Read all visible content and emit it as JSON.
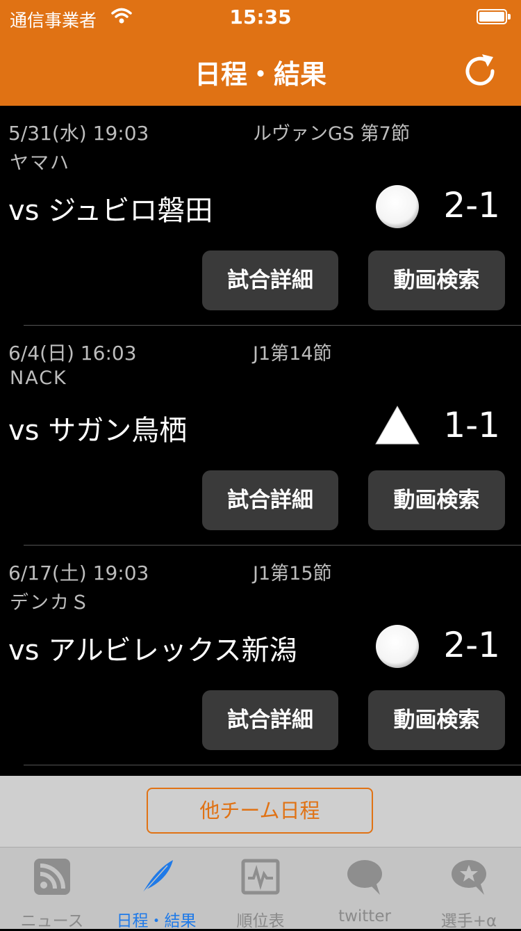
{
  "status_bar": {
    "carrier": "通信事業者",
    "time": "15:35"
  },
  "nav": {
    "title": "日程・結果",
    "refresh_icon": "refresh-icon"
  },
  "matches": [
    {
      "date": "5/31(水) 19:03",
      "competition": "ルヴァンGS 第7節",
      "venue": "ヤマハ",
      "opponent": "vs ジュビロ磐田",
      "result": "win",
      "score": "2-1",
      "detail_label": "試合詳細",
      "video_label": "動画検索"
    },
    {
      "date": "6/4(日) 16:03",
      "competition": "J1第14節",
      "venue": "NACK",
      "opponent": "vs サガン鳥栖",
      "result": "draw",
      "score": "1-1",
      "detail_label": "試合詳細",
      "video_label": "動画検索"
    },
    {
      "date": "6/17(土) 19:03",
      "competition": "J1第15節",
      "venue": "デンカＳ",
      "opponent": "vs アルビレックス新潟",
      "result": "win",
      "score": "2-1",
      "detail_label": "試合詳細",
      "video_label": "動画検索"
    }
  ],
  "other_teams_button": "他チーム日程",
  "tabs": [
    {
      "label": "ニュース",
      "icon": "rss-icon",
      "active": false
    },
    {
      "label": "日程・結果",
      "icon": "feather-icon",
      "active": true
    },
    {
      "label": "順位表",
      "icon": "chart-board-icon",
      "active": false
    },
    {
      "label": "twitter",
      "icon": "chat-bubble-icon",
      "active": false
    },
    {
      "label": "選手+α",
      "icon": "star-bubble-icon",
      "active": false
    }
  ],
  "colors": {
    "accent": "#e07214",
    "active_tab": "#1f7ae8",
    "background": "#000000"
  }
}
